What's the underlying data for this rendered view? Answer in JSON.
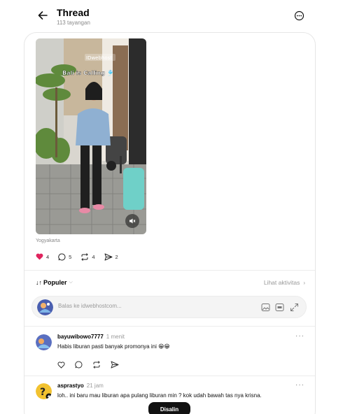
{
  "header": {
    "title": "Thread",
    "views": "113 tayangan"
  },
  "post": {
    "video_caption": "Bali is Calling 🎐",
    "video_watermark": "IDwebhost",
    "location": "Yogyakarta",
    "likes": "4",
    "comments": "5",
    "reposts": "4",
    "shares": "2"
  },
  "sort": {
    "arrows": "↓↑",
    "label": "Populer",
    "chevron": "⌵",
    "activity_label": "Lihat aktivitas",
    "activity_chevron": "›"
  },
  "reply": {
    "placeholder": "Balas ke idwebhostcom..."
  },
  "comments": [
    {
      "user": "bayuwibowo7777",
      "time": "1 menit",
      "text": "Habis liburan pasti banyak promonya ini 😁😁"
    },
    {
      "user": "asprastyo",
      "time": "21 jam",
      "text": "loh.. ini baru mau liburan apa pulang liburan min ? kok udah bawah tas nya krisna."
    }
  ],
  "toast": {
    "label": "Disalin"
  },
  "colors": {
    "like_red": "#e0245e",
    "divider": "#ececec",
    "muted_text": "#8a8a8a"
  }
}
